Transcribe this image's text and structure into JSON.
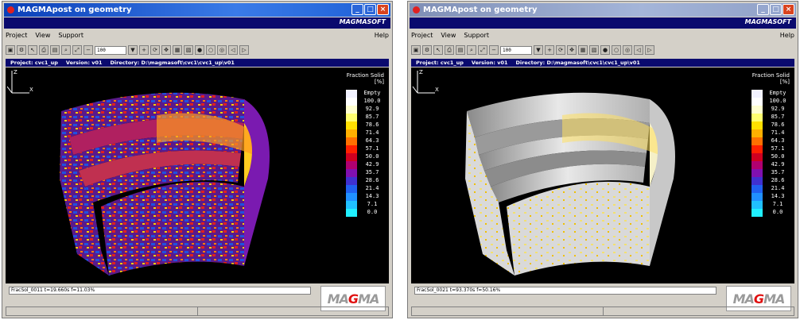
{
  "windows": [
    {
      "title": "MAGMApost on geometry",
      "brand": "MAGMASOFT",
      "menu": [
        "Project",
        "View",
        "Support"
      ],
      "help": "Help",
      "zoom": "100",
      "project_label": "Project: cvc1_up",
      "version_label": "Version: v01",
      "directory_label": "Directory: D:\\magmasoft\\cvc1\\cvc1_up\\v01",
      "status": "FracSol_0011 t=19.660s f=11.03%",
      "logo_left": "MA",
      "logo_mid": "G",
      "logo_right": "MA"
    },
    {
      "title": "MAGMApost on geometry",
      "brand": "MAGMASOFT",
      "menu": [
        "Project",
        "View",
        "Support"
      ],
      "help": "Help",
      "zoom": "100",
      "project_label": "Project: cvc1_up",
      "version_label": "Version: v01",
      "directory_label": "Directory: D:\\magmasoft\\cvc1\\cvc1_up\\v01",
      "status": "FracSol_0021 t=93.370s f=50.16%",
      "logo_left": "MA",
      "logo_mid": "G",
      "logo_right": "MA"
    }
  ],
  "legend": {
    "title": "Fraction Solid",
    "unit": "[%]",
    "labels": [
      "Empty",
      "100.0",
      "92.9",
      "85.7",
      "78.6",
      "71.4",
      "64.3",
      "57.1",
      "50.0",
      "42.9",
      "35.7",
      "28.6",
      "21.4",
      "14.3",
      "7.1",
      "0.0"
    ],
    "colors": [
      "#f2f2ff",
      "#ffffff",
      "#ffffd0",
      "#ffff70",
      "#ffe000",
      "#ffb000",
      "#ff7000",
      "#ff2000",
      "#d00020",
      "#b00070",
      "#8010b0",
      "#4030d0",
      "#2060f0",
      "#2090ff",
      "#20c0ff",
      "#20f0ff"
    ]
  },
  "axis_labels": {
    "z": "Z",
    "x": "X"
  }
}
